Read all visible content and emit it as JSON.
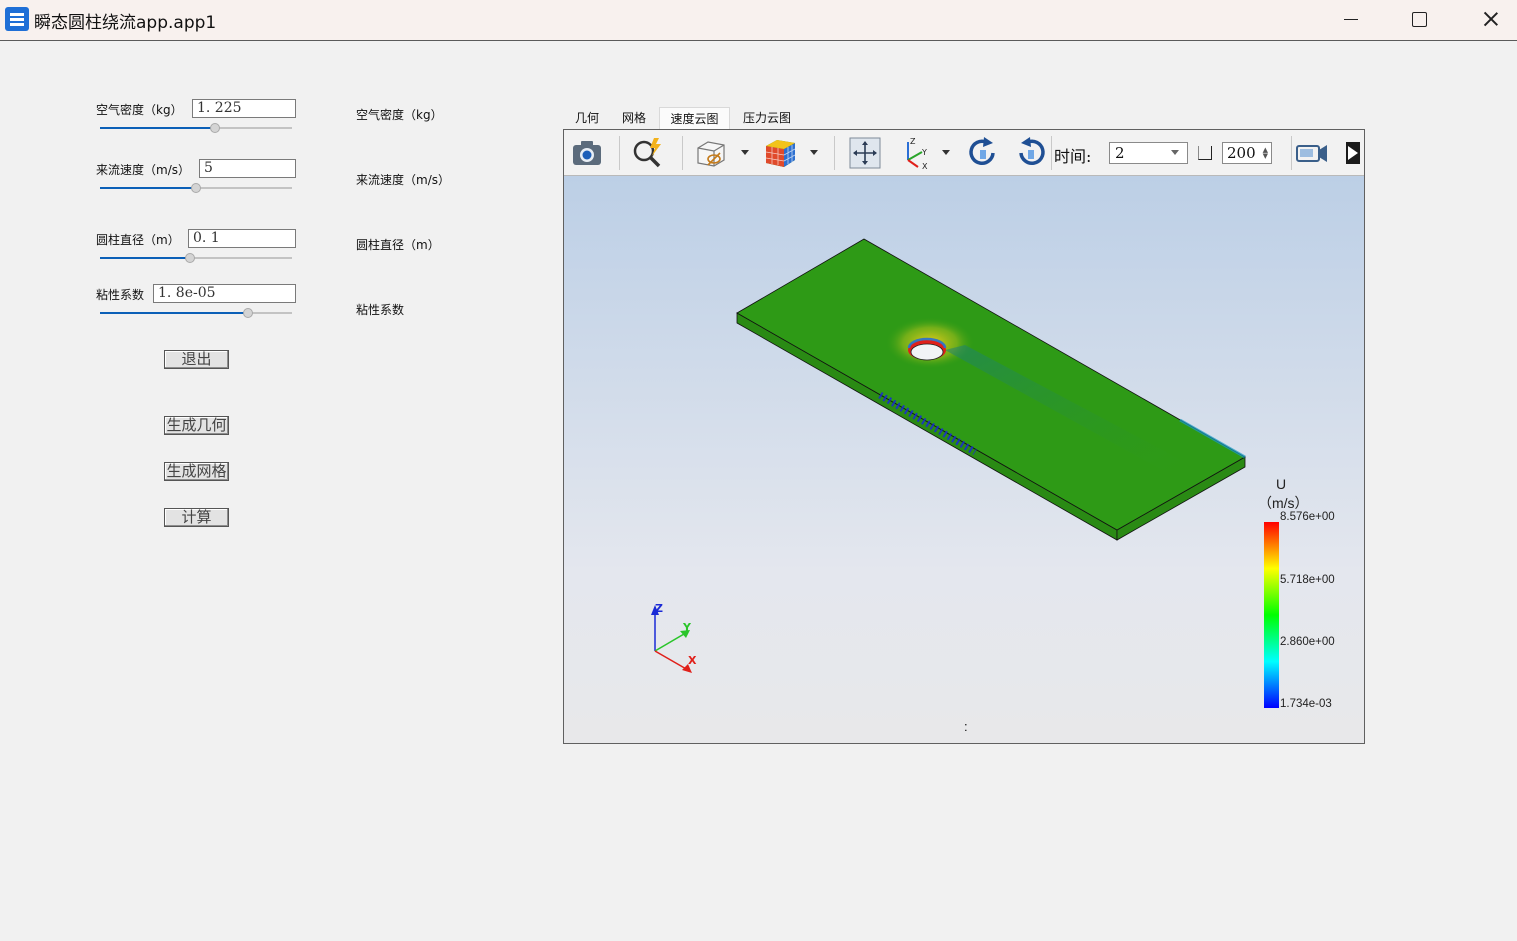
{
  "window": {
    "title": "瞬态圆柱绕流app.app1",
    "minimize_icon": "minimize-icon",
    "maximize_icon": "maximize-icon",
    "close_icon": "close-icon"
  },
  "params": {
    "density": {
      "label": "空气密度（kg）",
      "value": "1. 225",
      "slider_fraction": 0.6,
      "display_label": "空气密度（kg）"
    },
    "velocity": {
      "label": "来流速度（m/s）",
      "value": "5",
      "slider_fraction": 0.5,
      "display_label": "来流速度（m/s）"
    },
    "diameter": {
      "label": "圆柱直径（m）",
      "value": "0. 1",
      "slider_fraction": 0.47,
      "display_label": "圆柱直径（m）"
    },
    "viscosity": {
      "label": "粘性系数",
      "value": "1. 8e-05",
      "slider_fraction": 0.77,
      "display_label": "粘性系数"
    }
  },
  "buttons": {
    "exit": "退出",
    "geometry": "生成几何",
    "mesh": "生成网格",
    "compute": "计算"
  },
  "tabs": [
    {
      "label": "几何",
      "active": false
    },
    {
      "label": "网格",
      "active": false
    },
    {
      "label": "速度云图",
      "active": true
    },
    {
      "label": "压力云图",
      "active": false
    }
  ],
  "toolbar": {
    "icons": [
      "camera-icon",
      "zoom-select-icon",
      "box-view-icon",
      "color-cube-icon",
      "fit-view-icon",
      "axes-orient-icon",
      "rotate-cw-icon",
      "rotate-ccw-icon",
      "record-video-icon",
      "play-icon"
    ],
    "time_label": "时间:",
    "time_value": "2",
    "spin_value": "200"
  },
  "colorbar": {
    "title_line1": "U",
    "title_line2": "（m/s）",
    "max": "8.576e+00",
    "mid_high": "5.718e+00",
    "mid_low": "2.860e+00",
    "min": "1.734e-03",
    "colors": [
      "#0000ff",
      "#00ffff",
      "#00ff00",
      "#ffff00",
      "#ff0000"
    ]
  },
  "axes": {
    "x": "X",
    "y": "Y",
    "z": "Z",
    "x_color": "#e0201a",
    "y_color": "#2ac52a",
    "z_color": "#1a2ad6"
  },
  "scene": {
    "footer": ":",
    "plate_color": "#2e9a16"
  }
}
